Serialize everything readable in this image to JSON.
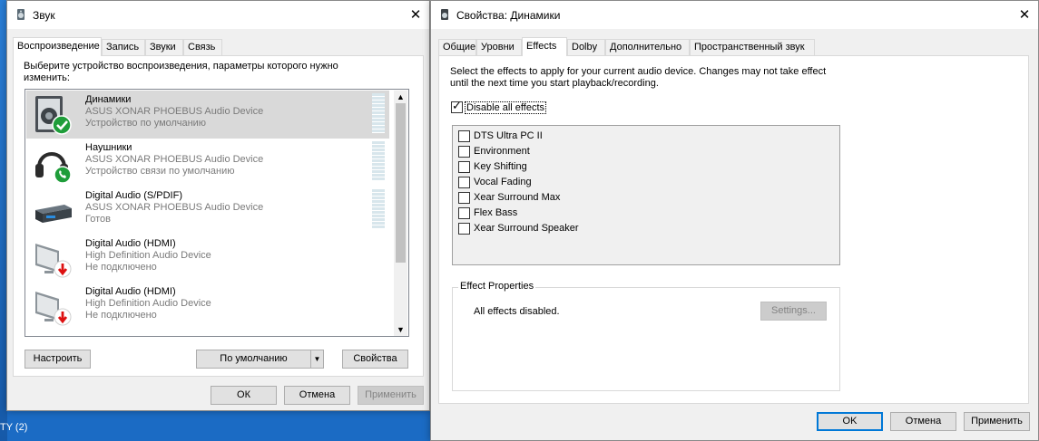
{
  "desktop": {
    "taskbar_label": "TY (2)"
  },
  "sound": {
    "title": "Звук",
    "close_glyph": "✕",
    "tabs": [
      "Воспроизведение",
      "Запись",
      "Звуки",
      "Связь"
    ],
    "instruction": "Выберите устройство воспроизведения, параметры которого нужно изменить:",
    "devices": [
      {
        "name": "Динамики",
        "driver": "ASUS XONAR PHOEBUS Audio Device",
        "status": "Устройство по умолчанию",
        "icon": "speaker-icon",
        "badge": "green-check-badge",
        "selected": true
      },
      {
        "name": "Наушники",
        "driver": "ASUS XONAR PHOEBUS Audio Device",
        "status": "Устройство связи по умолчанию",
        "icon": "headphones-icon",
        "badge": "green-phone-badge",
        "selected": false
      },
      {
        "name": "Digital Audio (S/PDIF)",
        "driver": "ASUS XONAR PHOEBUS Audio Device",
        "status": "Готов",
        "icon": "spdif-device-icon",
        "badge": "",
        "selected": false
      },
      {
        "name": "Digital Audio (HDMI)",
        "driver": "High Definition Audio Device",
        "status": "Не подключено",
        "icon": "monitor-icon",
        "badge": "red-down-arrow-badge",
        "selected": false
      },
      {
        "name": "Digital Audio (HDMI)",
        "driver": "High Definition Audio Device",
        "status": "Не подключено",
        "icon": "monitor-icon",
        "badge": "red-down-arrow-badge",
        "selected": false
      }
    ],
    "buttons": {
      "configure": "Настроить",
      "set_default": "По умолчанию",
      "properties": "Свойства",
      "ok": "ОК",
      "cancel": "Отмена",
      "apply": "Применить"
    }
  },
  "props": {
    "title": "Свойства: Динамики",
    "close_glyph": "✕",
    "tabs": [
      "Общие",
      "Уровни",
      "Effects",
      "Dolby",
      "Дополнительно",
      "Пространственный звук"
    ],
    "active_tab": "Effects",
    "description_line1": "Select the effects to apply for your current audio device. Changes may not take effect",
    "description_line2": "until the next time you start playback/recording.",
    "disable_all_label": "Disable all effects",
    "disable_all_checked": true,
    "effects": [
      "DTS Ultra PC II",
      "Environment",
      "Key Shifting",
      "Vocal Fading",
      "Xear Surround Max",
      "Flex Bass",
      "Xear Surround Speaker"
    ],
    "effect_properties_title": "Effect Properties",
    "effect_properties_text": "All effects disabled.",
    "settings_button": "Settings...",
    "buttons": {
      "ok": "OK",
      "cancel": "Отмена",
      "apply": "Применить"
    }
  }
}
